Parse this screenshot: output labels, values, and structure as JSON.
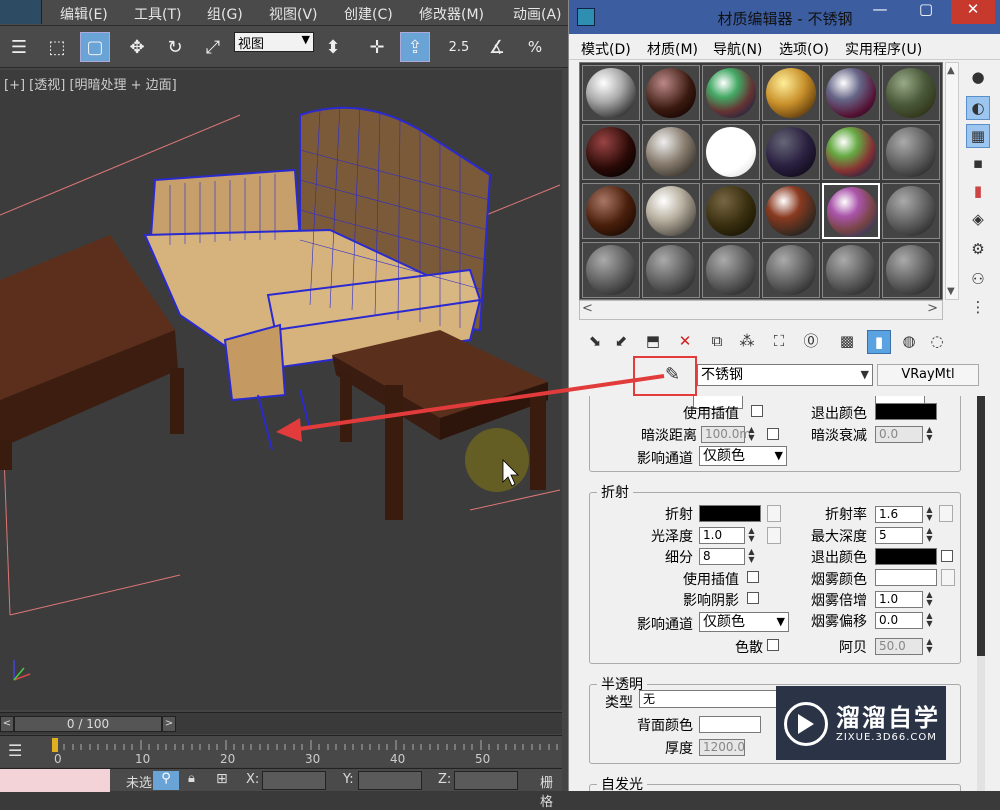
{
  "max": {
    "menu": [
      "编辑(E)",
      "工具(T)",
      "组(G)",
      "视图(V)",
      "创建(C)",
      "修改器(M)",
      "动画(A)"
    ],
    "view_select": "视图",
    "snap_label": "2.5",
    "viewport_label": "[+] [透视] [明暗处理 + 边面]",
    "frame_counter": "0 / 100",
    "ticks": [
      "0",
      "10",
      "20",
      "30",
      "40",
      "50"
    ],
    "status": {
      "x_label": "X:",
      "y_label": "Y:",
      "z_label": "Z:",
      "mode_text": "未选",
      "grid_text": "栅格"
    }
  },
  "editor": {
    "title": "材质编辑器 - 不锈钢",
    "menu": [
      "模式(D)",
      "材质(M)",
      "导航(N)",
      "选项(O)",
      "实用程序(U)"
    ],
    "material_name": "不锈钢",
    "material_type": "VRayMtl",
    "reflection_fragment": {
      "use_interp_label": "使用插值",
      "exit_color_label": "退出颜色",
      "dim_distance_label": "暗淡距离",
      "dim_distance_value": "100.0m",
      "dim_falloff_label": "暗淡衰减",
      "dim_falloff_value": "0.0",
      "affect_channels_label": "影响通道",
      "affect_channels_value": "仅颜色"
    },
    "refraction": {
      "title": "折射",
      "refract_label": "折射",
      "ior_label": "折射率",
      "ior_value": "1.6",
      "glossiness_label": "光泽度",
      "glossiness_value": "1.0",
      "max_depth_label": "最大深度",
      "max_depth_value": "5",
      "subdivs_label": "细分",
      "subdivs_value": "8",
      "exit_color_label": "退出颜色",
      "use_interp_label": "使用插值",
      "fog_color_label": "烟雾颜色",
      "affect_shadows_label": "影响阴影",
      "fog_multiplier_label": "烟雾倍增",
      "fog_multiplier_value": "1.0",
      "affect_channels_label": "影响通道",
      "affect_channels_value": "仅颜色",
      "fog_bias_label": "烟雾偏移",
      "fog_bias_value": "0.0",
      "dispersion_label": "色散",
      "abbe_label": "阿贝",
      "abbe_value": "50.0"
    },
    "translucency": {
      "title": "半透明",
      "type_label": "类型",
      "type_value": "无",
      "back_color_label": "背面颜色",
      "thickness_label": "厚度",
      "thickness_value": "1200.0"
    },
    "self_illum": {
      "title": "自发光"
    }
  },
  "watermark": {
    "title": "溜溜自学",
    "subtitle": "ZIXUE.3D66.COM"
  }
}
